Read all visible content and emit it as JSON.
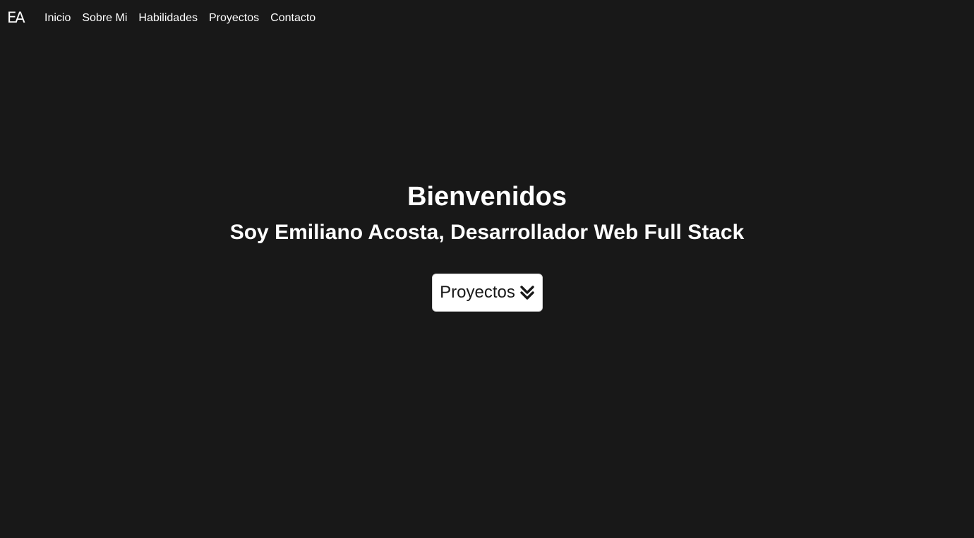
{
  "brand": {
    "logo_text": "EA"
  },
  "nav": {
    "items": [
      {
        "label": "Inicio"
      },
      {
        "label": "Sobre Mi"
      },
      {
        "label": "Habilidades"
      },
      {
        "label": "Proyectos"
      },
      {
        "label": "Contacto"
      }
    ]
  },
  "hero": {
    "title": "Bienvenidos",
    "subtitle": "Soy Emiliano Acosta, Desarrollador Web Full Stack",
    "button_label": "Proyectos",
    "button_icon": "double-chevron-down-icon"
  },
  "colors": {
    "background": "#181818",
    "text": "#ffffff",
    "button_background": "#ffffff",
    "button_text": "#181818"
  }
}
